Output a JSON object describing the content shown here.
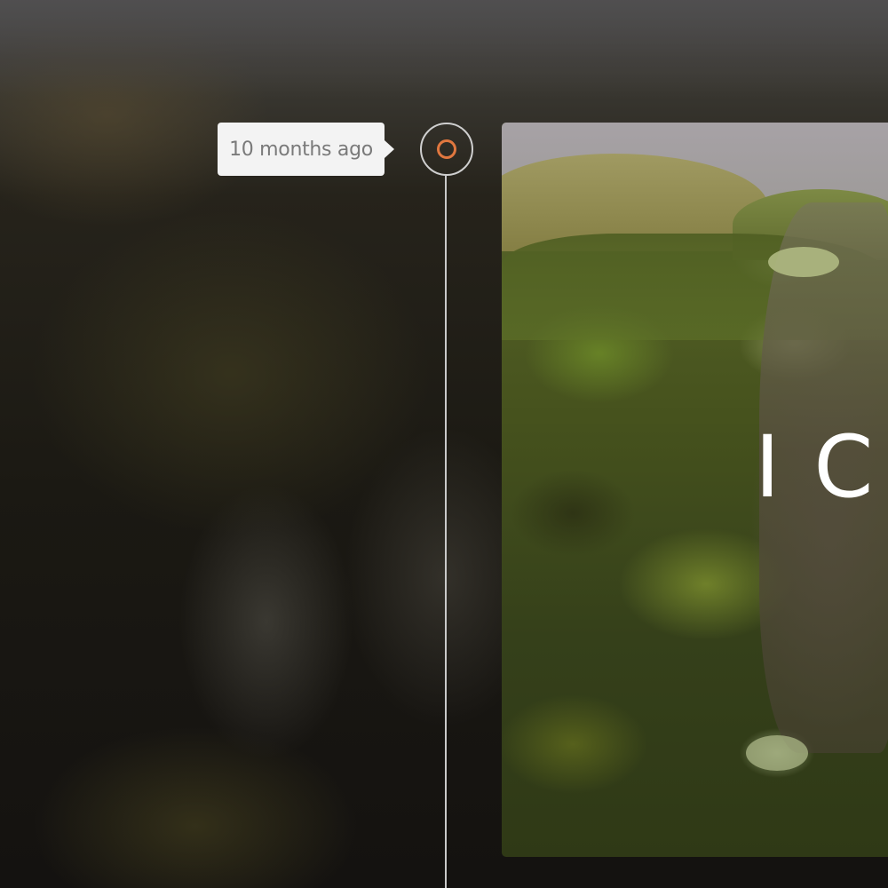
{
  "timeline": {
    "timestamp_label": "10 months ago",
    "marker_color": "#e0773f",
    "line_color": "#c9c9c9"
  },
  "post": {
    "image_title_visible": "IC"
  },
  "icons": {
    "marker": "timeline-marker-icon",
    "arrow": "tooltip-arrow"
  }
}
